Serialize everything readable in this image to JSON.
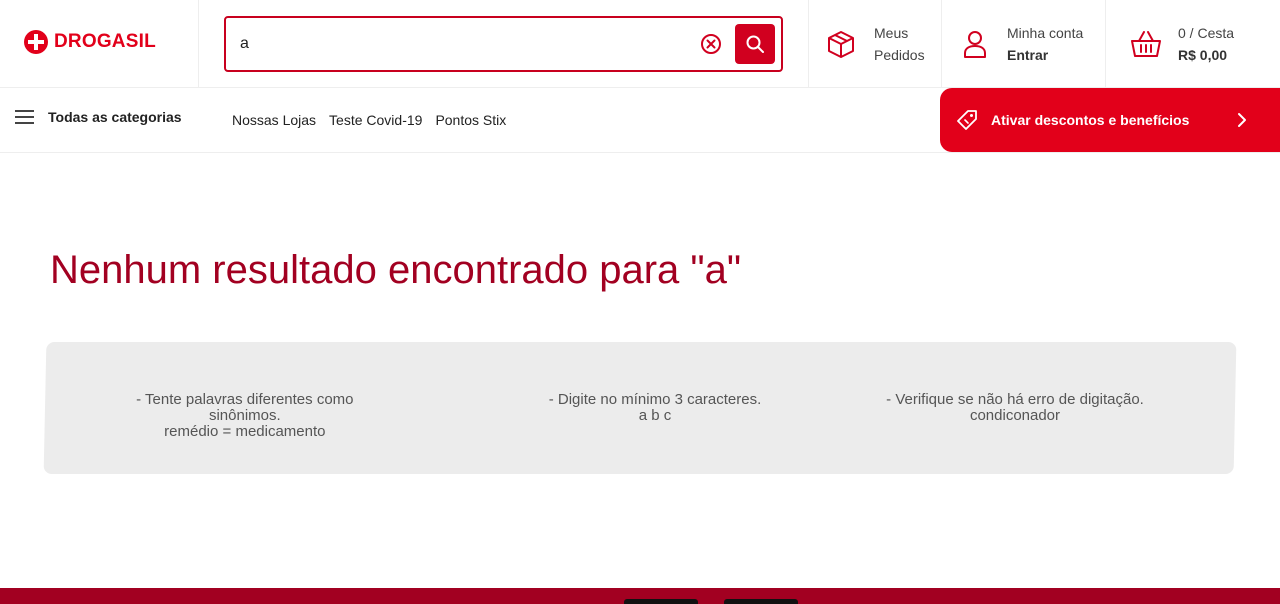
{
  "brand": {
    "name": "DROGASIL",
    "color": "#e2001a",
    "dark_red": "#a20021"
  },
  "search": {
    "value": "a",
    "placeholder": "",
    "clear_icon": "circle-x-icon",
    "submit_icon": "search-icon"
  },
  "header": {
    "orders": {
      "line1": "Meus",
      "line2": "Pedidos",
      "icon": "box-icon"
    },
    "account": {
      "line1": "Minha conta",
      "line2": "Entrar",
      "icon": "user-icon"
    },
    "cart": {
      "line1": "0 / Cesta",
      "line2": "R$ 0,00",
      "icon": "basket-icon"
    }
  },
  "nav": {
    "categories_label": "Todas as categorias",
    "links": [
      "Nossas Lojas",
      "Teste Covid-19",
      "Pontos Stix"
    ],
    "promo_label": "Ativar descontos e benefícios"
  },
  "main": {
    "title": "Nenhum resultado encontrado para \"a\"",
    "tips": [
      {
        "line1": "- Tente palavras diferentes como sinônimos.",
        "line2": "remédio = medicamento"
      },
      {
        "line1": "- Digite no mínimo 3 caracteres.",
        "line2": "a b c"
      },
      {
        "line1": "- Verifique se não há erro de digitação.",
        "line2": "condiconador"
      }
    ]
  }
}
